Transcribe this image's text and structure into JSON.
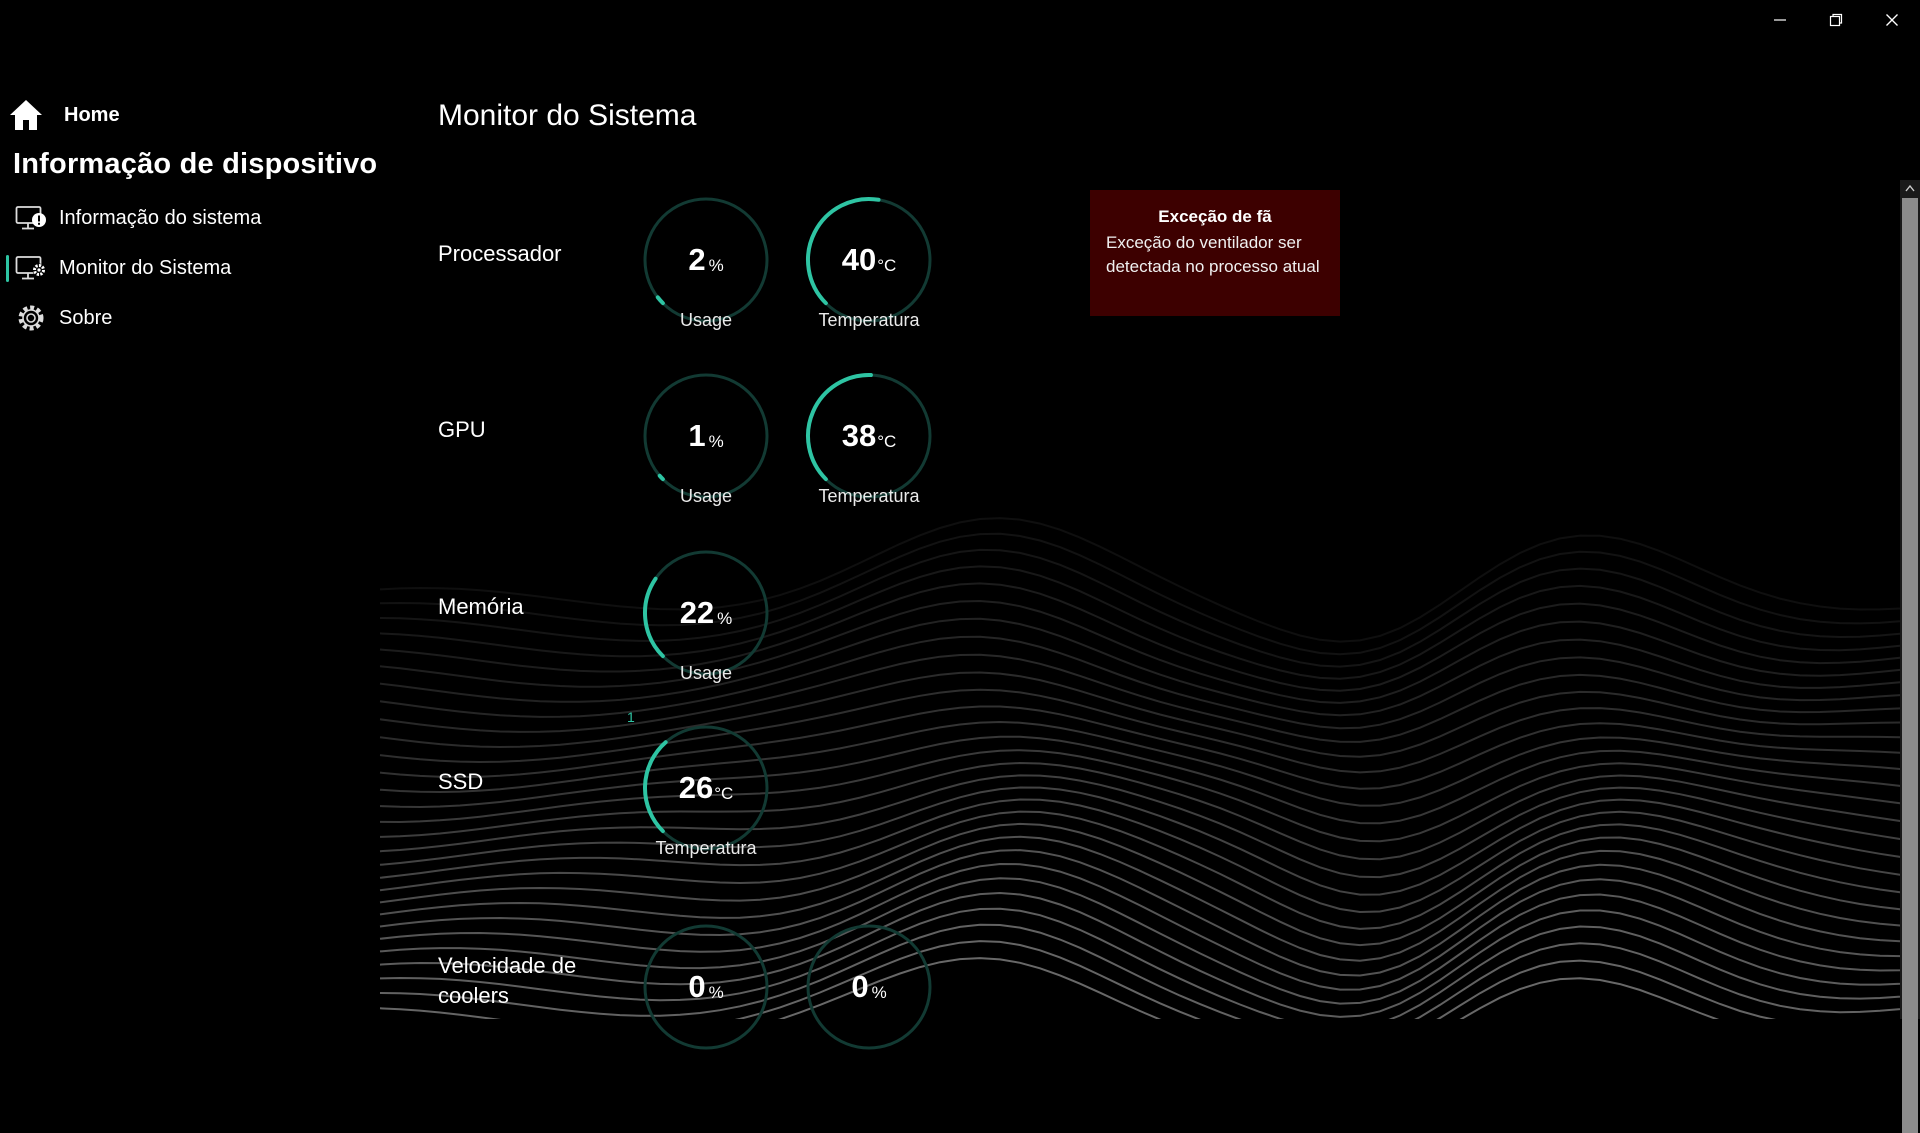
{
  "window": {
    "controls": [
      "minimize",
      "restore",
      "close"
    ]
  },
  "sidebar": {
    "home_label": "Home",
    "section_title": "Informação de dispositivo",
    "items": [
      {
        "label": "Informação do sistema",
        "icon": "monitor-info-icon"
      },
      {
        "label": "Monitor do Sistema",
        "icon": "monitor-gear-icon",
        "active": true
      },
      {
        "label": "Sobre",
        "icon": "gear-icon"
      }
    ]
  },
  "main": {
    "title": "Monitor do Sistema",
    "rows": {
      "processor": {
        "label": "Processador",
        "usage": {
          "value": "2",
          "unit": "%",
          "label": "Usage",
          "fraction": 0.02
        },
        "temp": {
          "value": "40",
          "unit": "°C",
          "label": "Temperatura",
          "fraction": 0.4
        }
      },
      "gpu": {
        "label": "GPU",
        "usage": {
          "value": "1",
          "unit": "%",
          "label": "Usage",
          "fraction": 0.01
        },
        "temp": {
          "value": "38",
          "unit": "°C",
          "label": "Temperatura",
          "fraction": 0.38
        }
      },
      "memory": {
        "label": "Memória",
        "usage": {
          "value": "22",
          "unit": "%",
          "label": "Usage",
          "fraction": 0.22
        }
      },
      "ssd": {
        "label": "SSD",
        "index": "1",
        "temp": {
          "value": "26",
          "unit": "°C",
          "label": "Temperatura",
          "fraction": 0.26
        }
      },
      "fans": {
        "label": "Velocidade de coolers",
        "fan1": {
          "value": "0",
          "unit": "%",
          "fraction": 0
        },
        "fan2": {
          "value": "0",
          "unit": "%",
          "fraction": 0
        }
      }
    }
  },
  "alert": {
    "title": "Exceção de fã",
    "message": "Exceção do ventilador ser detectada no processo atual"
  },
  "colors": {
    "accent": "#2ec4a3",
    "gauge_track": "#123a33",
    "alert_bg": "#3d0000",
    "background": "#000000"
  }
}
